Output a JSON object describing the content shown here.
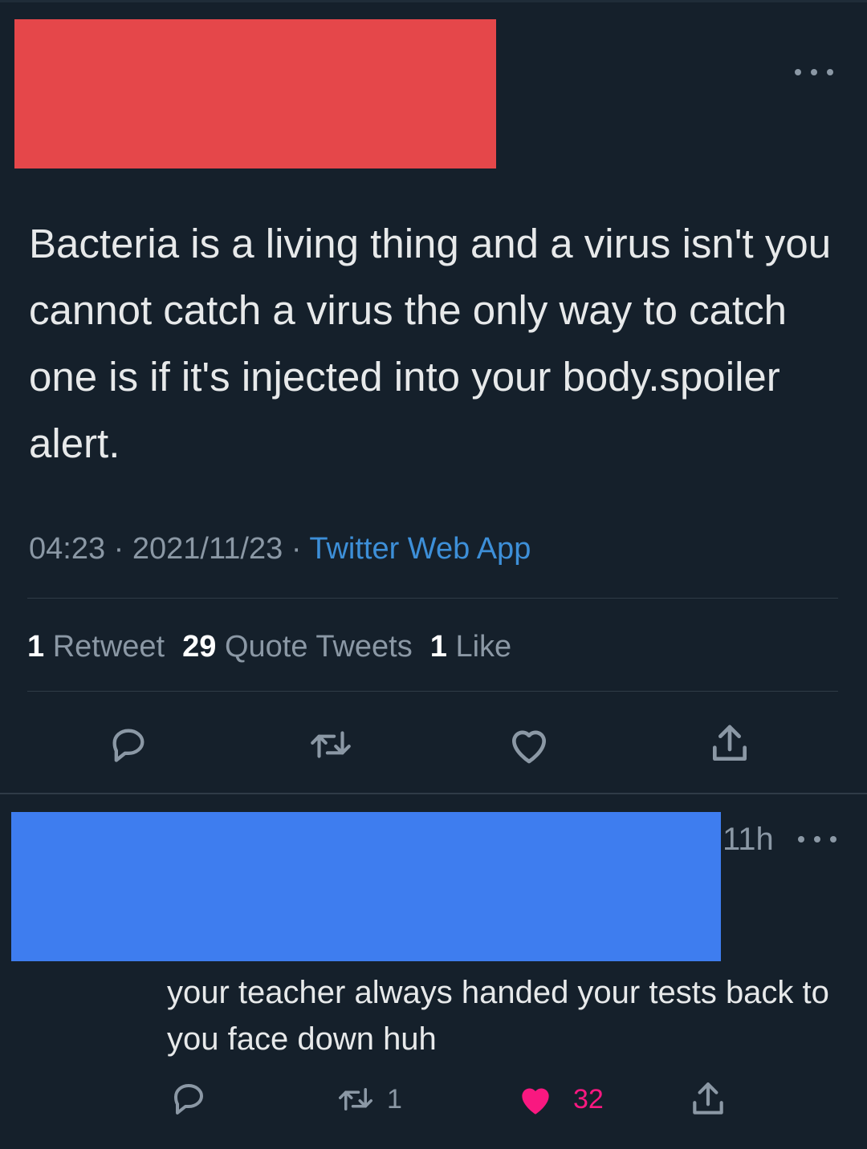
{
  "tweet": {
    "text": "Bacteria is a living thing and a virus isn't you cannot catch a virus the only way to catch one is if it's injected into your body.spoiler alert.",
    "time": "04:23",
    "date": "2021/11/23",
    "separator": "·",
    "source": "Twitter Web App",
    "stats": {
      "retweets_count": "1",
      "retweets_label": "Retweet",
      "quote_count": "29",
      "quote_label": "Quote Tweets",
      "likes_count": "1",
      "likes_label": "Like"
    },
    "actions": [
      "reply-icon",
      "retweet-icon",
      "like-icon",
      "share-icon"
    ]
  },
  "reply": {
    "time": "11h",
    "text": "your teacher always handed your tests back to you face down huh",
    "retweet_count": "1",
    "like_count": "32",
    "liked": true
  },
  "colors": {
    "background": "#15202b",
    "text": "#e7e9ea",
    "muted": "#8b98a5",
    "link": "#3d8fd8",
    "like_pink": "#f91880",
    "redaction_red": "#e5474a",
    "redaction_blue": "#3e7def"
  }
}
